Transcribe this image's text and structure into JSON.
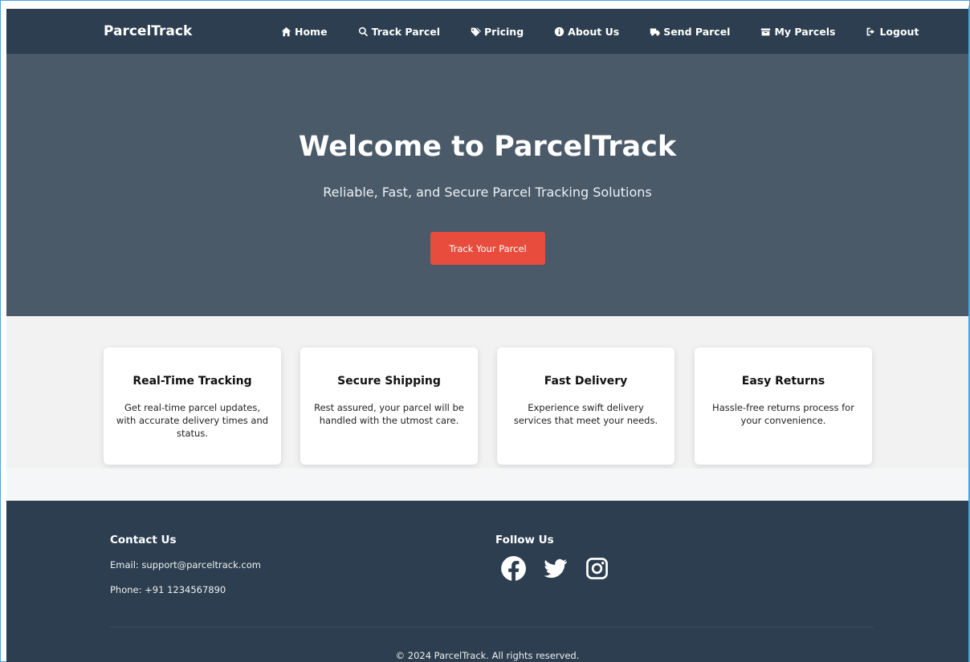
{
  "navbar": {
    "brand": "ParcelTrack",
    "items": [
      {
        "label": "Home",
        "icon": "home-icon"
      },
      {
        "label": "Track Parcel",
        "icon": "search-icon"
      },
      {
        "label": "Pricing",
        "icon": "tags-icon"
      },
      {
        "label": "About Us",
        "icon": "info-circle-icon"
      },
      {
        "label": "Send Parcel",
        "icon": "truck-icon"
      },
      {
        "label": "My Parcels",
        "icon": "box-icon"
      },
      {
        "label": "Logout",
        "icon": "logout-icon"
      }
    ]
  },
  "hero": {
    "title": "Welcome to ParcelTrack",
    "subtitle": "Reliable, Fast, and Secure Parcel Tracking Solutions",
    "button_label": "Track Your Parcel"
  },
  "features": [
    {
      "title": "Real-Time Tracking",
      "description": "Get real-time parcel updates, with accurate delivery times and status."
    },
    {
      "title": "Secure Shipping",
      "description": "Rest assured, your parcel will be handled with the utmost care."
    },
    {
      "title": "Fast Delivery",
      "description": "Experience swift delivery services that meet your needs."
    },
    {
      "title": "Easy Returns",
      "description": "Hassle-free returns process for your convenience."
    }
  ],
  "footer": {
    "contact_heading": "Contact Us",
    "email": "Email: support@parceltrack.com",
    "phone": "Phone: +91 1234567890",
    "follow_heading": "Follow Us",
    "social": [
      "facebook-icon",
      "twitter-icon",
      "instagram-icon"
    ],
    "copyright": "© 2024 ParcelTrack. All rights reserved."
  },
  "colors": {
    "navbar_bg": "#2c3e50",
    "hero_bg": "#4a5a69",
    "accent_button": "#e74c3c",
    "features_bg": "#f2f2f2",
    "footer_bg": "#2c3e50"
  }
}
